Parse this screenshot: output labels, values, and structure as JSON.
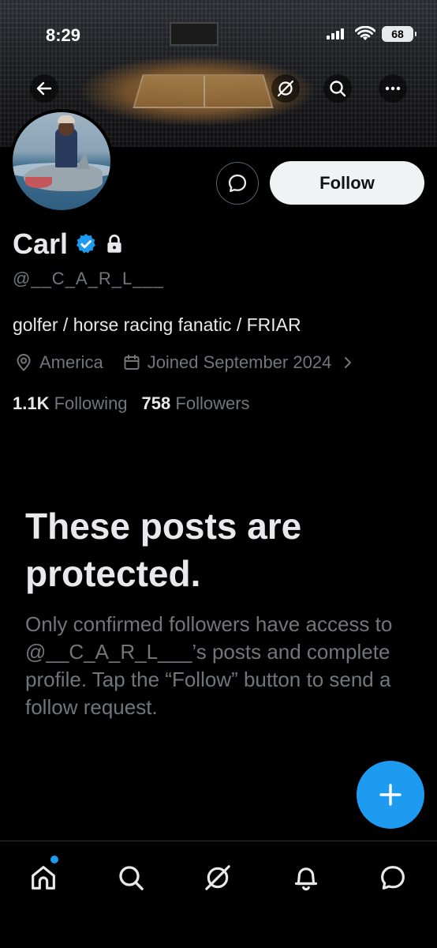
{
  "status_bar": {
    "time": "8:29",
    "battery": "68"
  },
  "profile": {
    "display_name": "Carl",
    "handle": "@__C_A_R_L___",
    "bio": "golfer / horse racing fanatic / FRIAR",
    "location": "America",
    "joined": "Joined September 2024",
    "following_count": "1.1K",
    "following_label": "Following",
    "followers_count": "758",
    "followers_label": "Followers",
    "verified": true,
    "protected": true
  },
  "actions": {
    "follow_label": "Follow"
  },
  "protected_notice": {
    "title": "These posts are protected.",
    "body": "Only confirmed followers have access to @__C_A_R_L___’s posts and complete profile. Tap the “Follow” button to send a follow request."
  },
  "bottom_nav": {
    "items": [
      "home-icon",
      "search-icon",
      "grok-icon",
      "notifications-icon",
      "messages-icon"
    ],
    "home_has_notification": true
  },
  "colors": {
    "accent": "#1d9bf0",
    "background": "#000000",
    "secondary_text": "#71767b",
    "primary_text": "#e7e9ea"
  }
}
